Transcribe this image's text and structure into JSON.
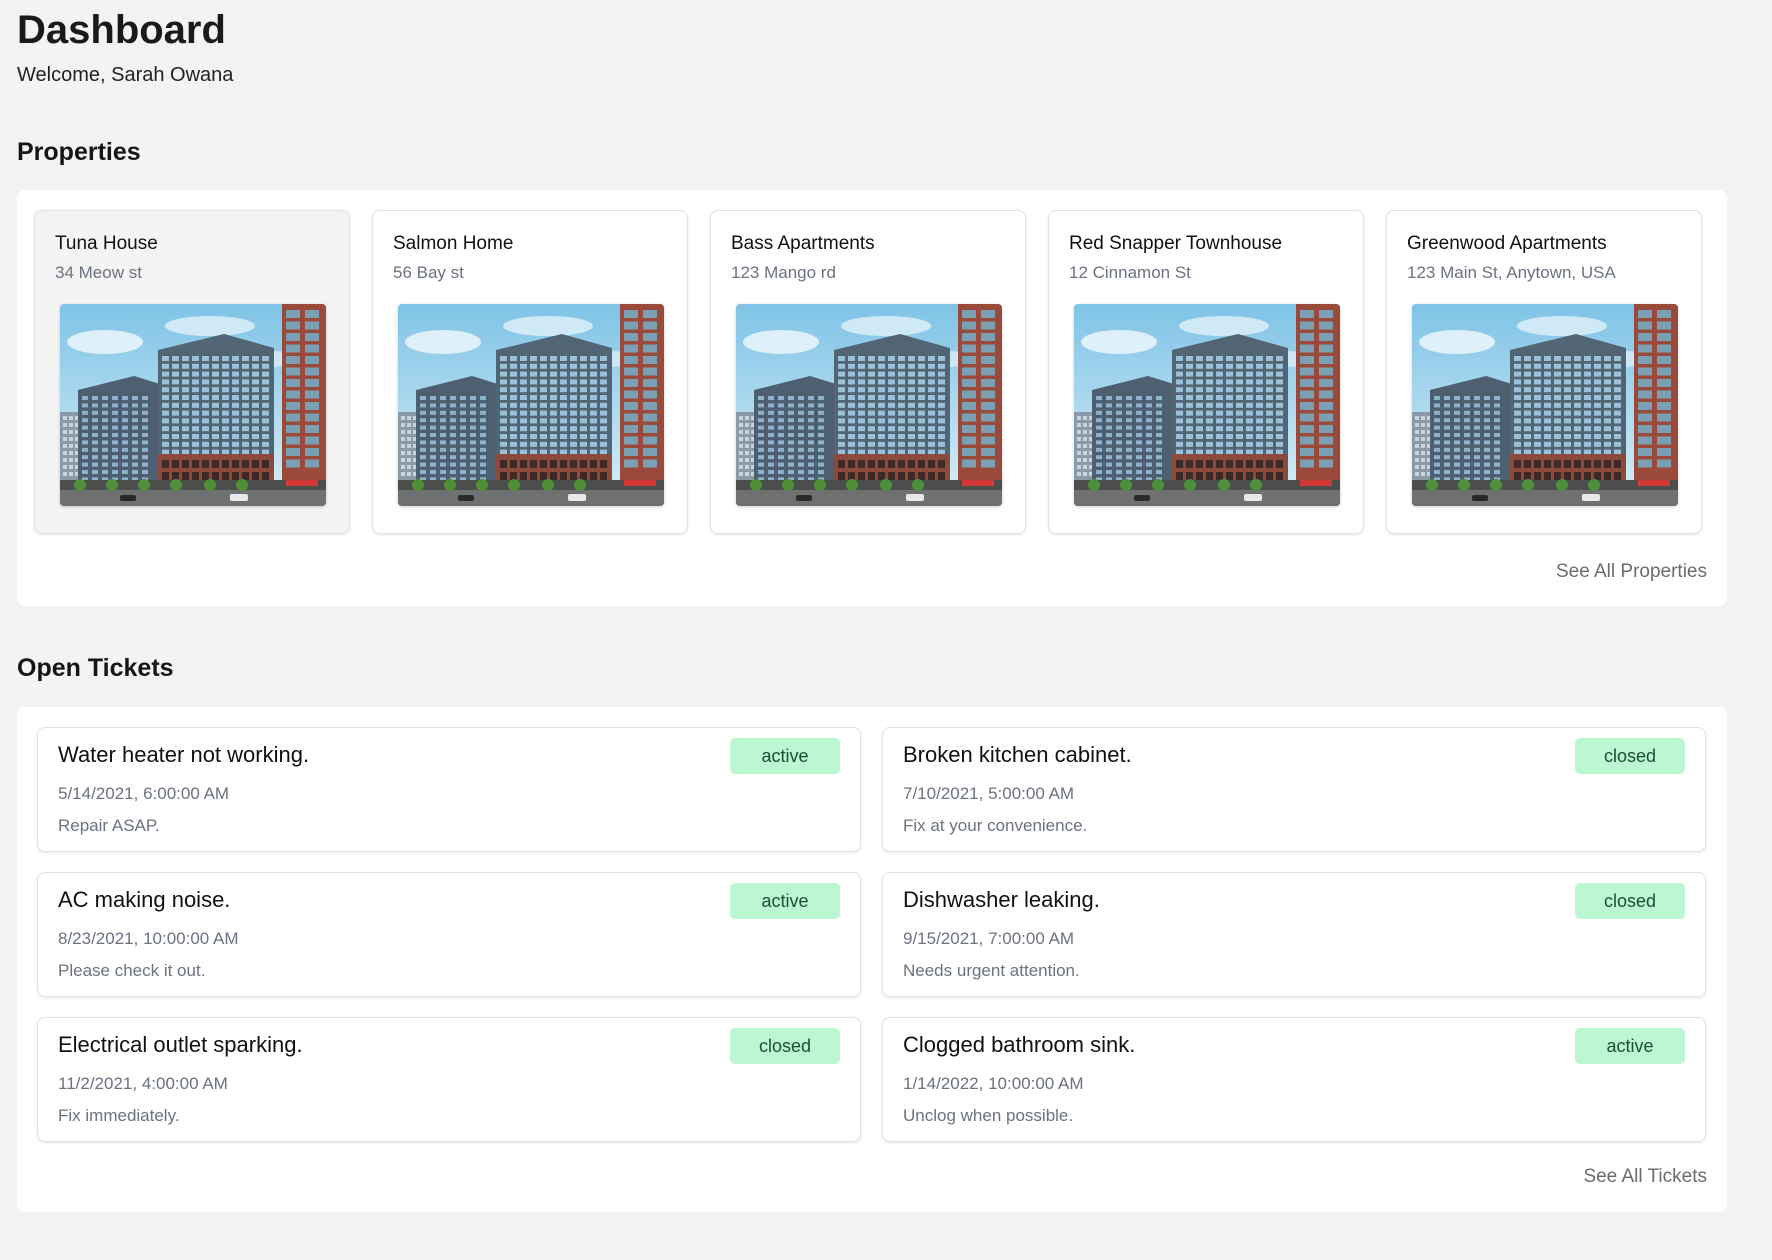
{
  "header": {
    "title": "Dashboard",
    "welcome": "Welcome, Sarah Owana"
  },
  "properties": {
    "section_title": "Properties",
    "see_all": "See All Properties",
    "items": [
      {
        "name": "Tuna House",
        "address": "34 Meow st",
        "selected": true
      },
      {
        "name": "Salmon Home",
        "address": "56 Bay st",
        "selected": false
      },
      {
        "name": "Bass Apartments",
        "address": "123 Mango rd",
        "selected": false
      },
      {
        "name": "Red Snapper Townhouse",
        "address": "12 Cinnamon St",
        "selected": false
      },
      {
        "name": "Greenwood Apartments",
        "address": "123 Main St, Anytown, USA",
        "selected": false
      }
    ]
  },
  "tickets": {
    "section_title": "Open Tickets",
    "see_all": "See All Tickets",
    "items": [
      {
        "title": "Water heater not working.",
        "date": "5/14/2021, 6:00:00 AM",
        "description": "Repair ASAP.",
        "status": "active"
      },
      {
        "title": "Broken kitchen cabinet.",
        "date": "7/10/2021, 5:00:00 AM",
        "description": "Fix at your convenience.",
        "status": "closed"
      },
      {
        "title": "AC making noise.",
        "date": "8/23/2021, 10:00:00 AM",
        "description": "Please check it out.",
        "status": "active"
      },
      {
        "title": "Dishwasher leaking.",
        "date": "9/15/2021, 7:00:00 AM",
        "description": "Needs urgent attention.",
        "status": "closed"
      },
      {
        "title": "Electrical outlet sparking.",
        "date": "11/2/2021, 4:00:00 AM",
        "description": "Fix immediately.",
        "status": "closed"
      },
      {
        "title": "Clogged bathroom sink.",
        "date": "1/14/2022, 10:00:00 AM",
        "description": "Unclog when possible.",
        "status": "active"
      }
    ]
  },
  "colors": {
    "page_background": "#f3f3f3",
    "panel_background": "#ffffff",
    "badge_background": "#bbf7d0",
    "badge_text": "#14532d",
    "muted_text": "#6b7280"
  }
}
